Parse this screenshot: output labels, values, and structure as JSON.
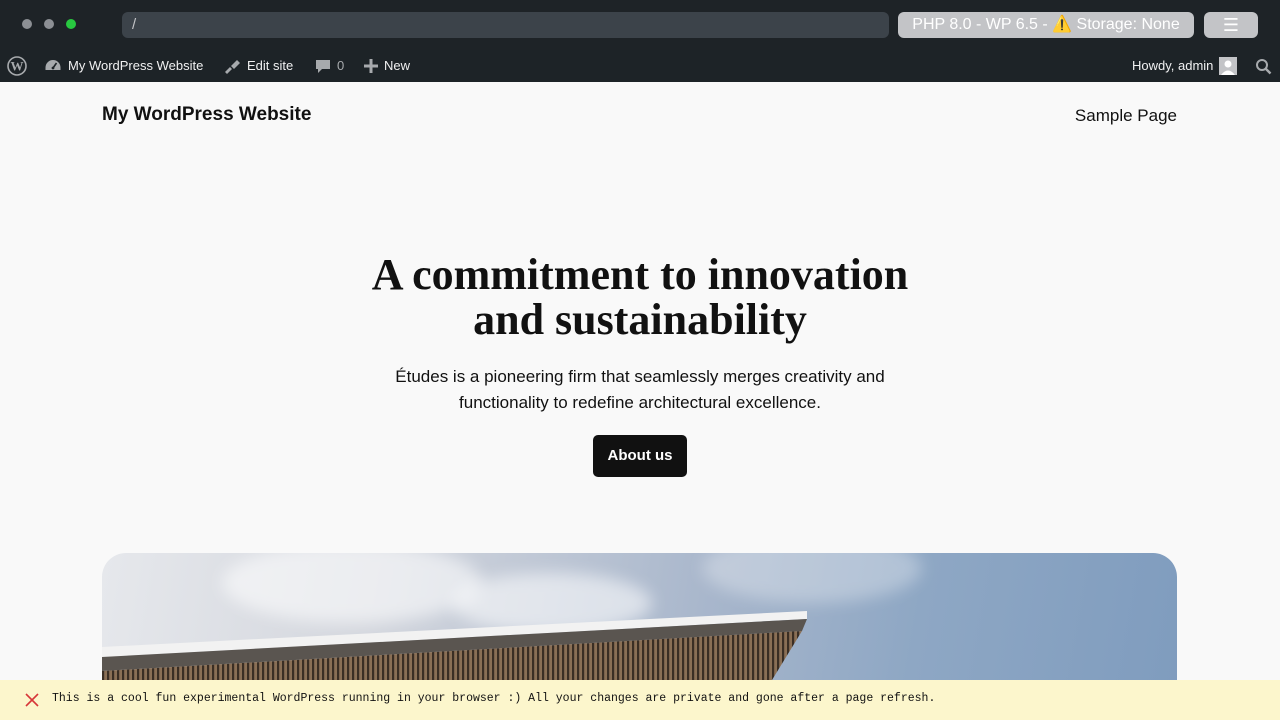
{
  "browser": {
    "url": "/",
    "env_label": "PHP 8.0 - WP 6.5 - ⚠️ Storage: None",
    "menu_icon": "☰"
  },
  "adminbar": {
    "site_name": "My WordPress Website",
    "edit_site": "Edit site",
    "comments_count": "0",
    "new_label": "New",
    "howdy": "Howdy, admin"
  },
  "site": {
    "title": "My WordPress Website",
    "nav": [
      "Sample Page"
    ]
  },
  "hero": {
    "title": "A commitment to innovation and sustainability",
    "description": "Études is a pioneering firm that seamlessly merges creativity and functionality to redefine architectural excellence.",
    "button": "About us"
  },
  "notice": {
    "text": "This is a cool fun experimental WordPress running in your browser :) All your changes are private and gone after a page refresh."
  },
  "colors": {
    "adminbar_bg": "#1d2327",
    "notice_bg": "#fcf6cc",
    "button_bg": "#111111",
    "page_bg": "#f9f9f9"
  }
}
